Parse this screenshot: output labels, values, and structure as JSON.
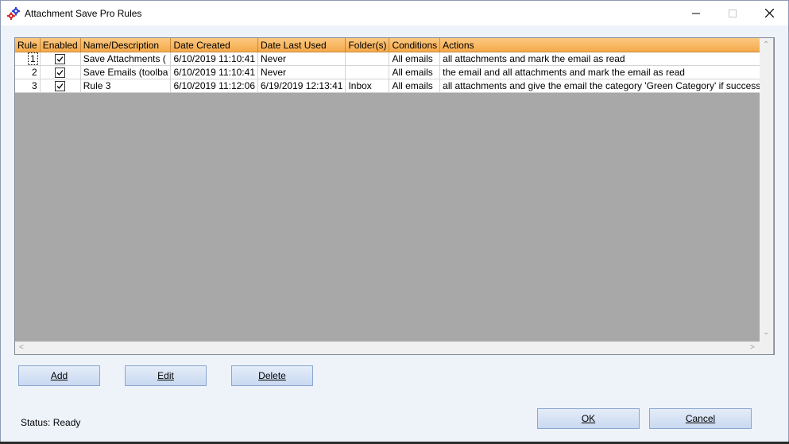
{
  "window": {
    "title": "Attachment Save Pro Rules"
  },
  "grid": {
    "columns": [
      "Rule",
      "Enabled",
      "Name/Description",
      "Date Created",
      "Date Last Used",
      "Folder(s)",
      "Conditions",
      "Actions"
    ],
    "rows": [
      {
        "rule": "1",
        "enabled": true,
        "name": "Save Attachments (",
        "created": "6/10/2019 11:10:41",
        "last_used": "Never",
        "folders": "",
        "conditions": "All emails",
        "actions": "all attachments and mark the email as read"
      },
      {
        "rule": "2",
        "enabled": true,
        "name": "Save Emails (toolba",
        "created": "6/10/2019 11:10:41",
        "last_used": "Never",
        "folders": "",
        "conditions": "All emails",
        "actions": "the email and all attachments and mark the email as read"
      },
      {
        "rule": "3",
        "enabled": true,
        "name": "Rule 3",
        "created": "6/10/2019 11:12:06",
        "last_used": "6/19/2019 12:13:41",
        "folders": "Inbox",
        "conditions": "All emails",
        "actions": "all attachments and give the email the category 'Green Category' if successful o"
      }
    ]
  },
  "buttons": {
    "add": "Add",
    "edit": "Edit",
    "delete": "Delete",
    "ok": "OK",
    "cancel": "Cancel"
  },
  "status": "Status: Ready",
  "colors": {
    "header": "#f5a94a",
    "empty_area": "#a8a8a8",
    "button": "#c9d9f1"
  },
  "icons": {
    "app": "gears-icon",
    "minimize": "minimize-icon",
    "maximize": "maximize-icon",
    "close": "close-icon"
  }
}
